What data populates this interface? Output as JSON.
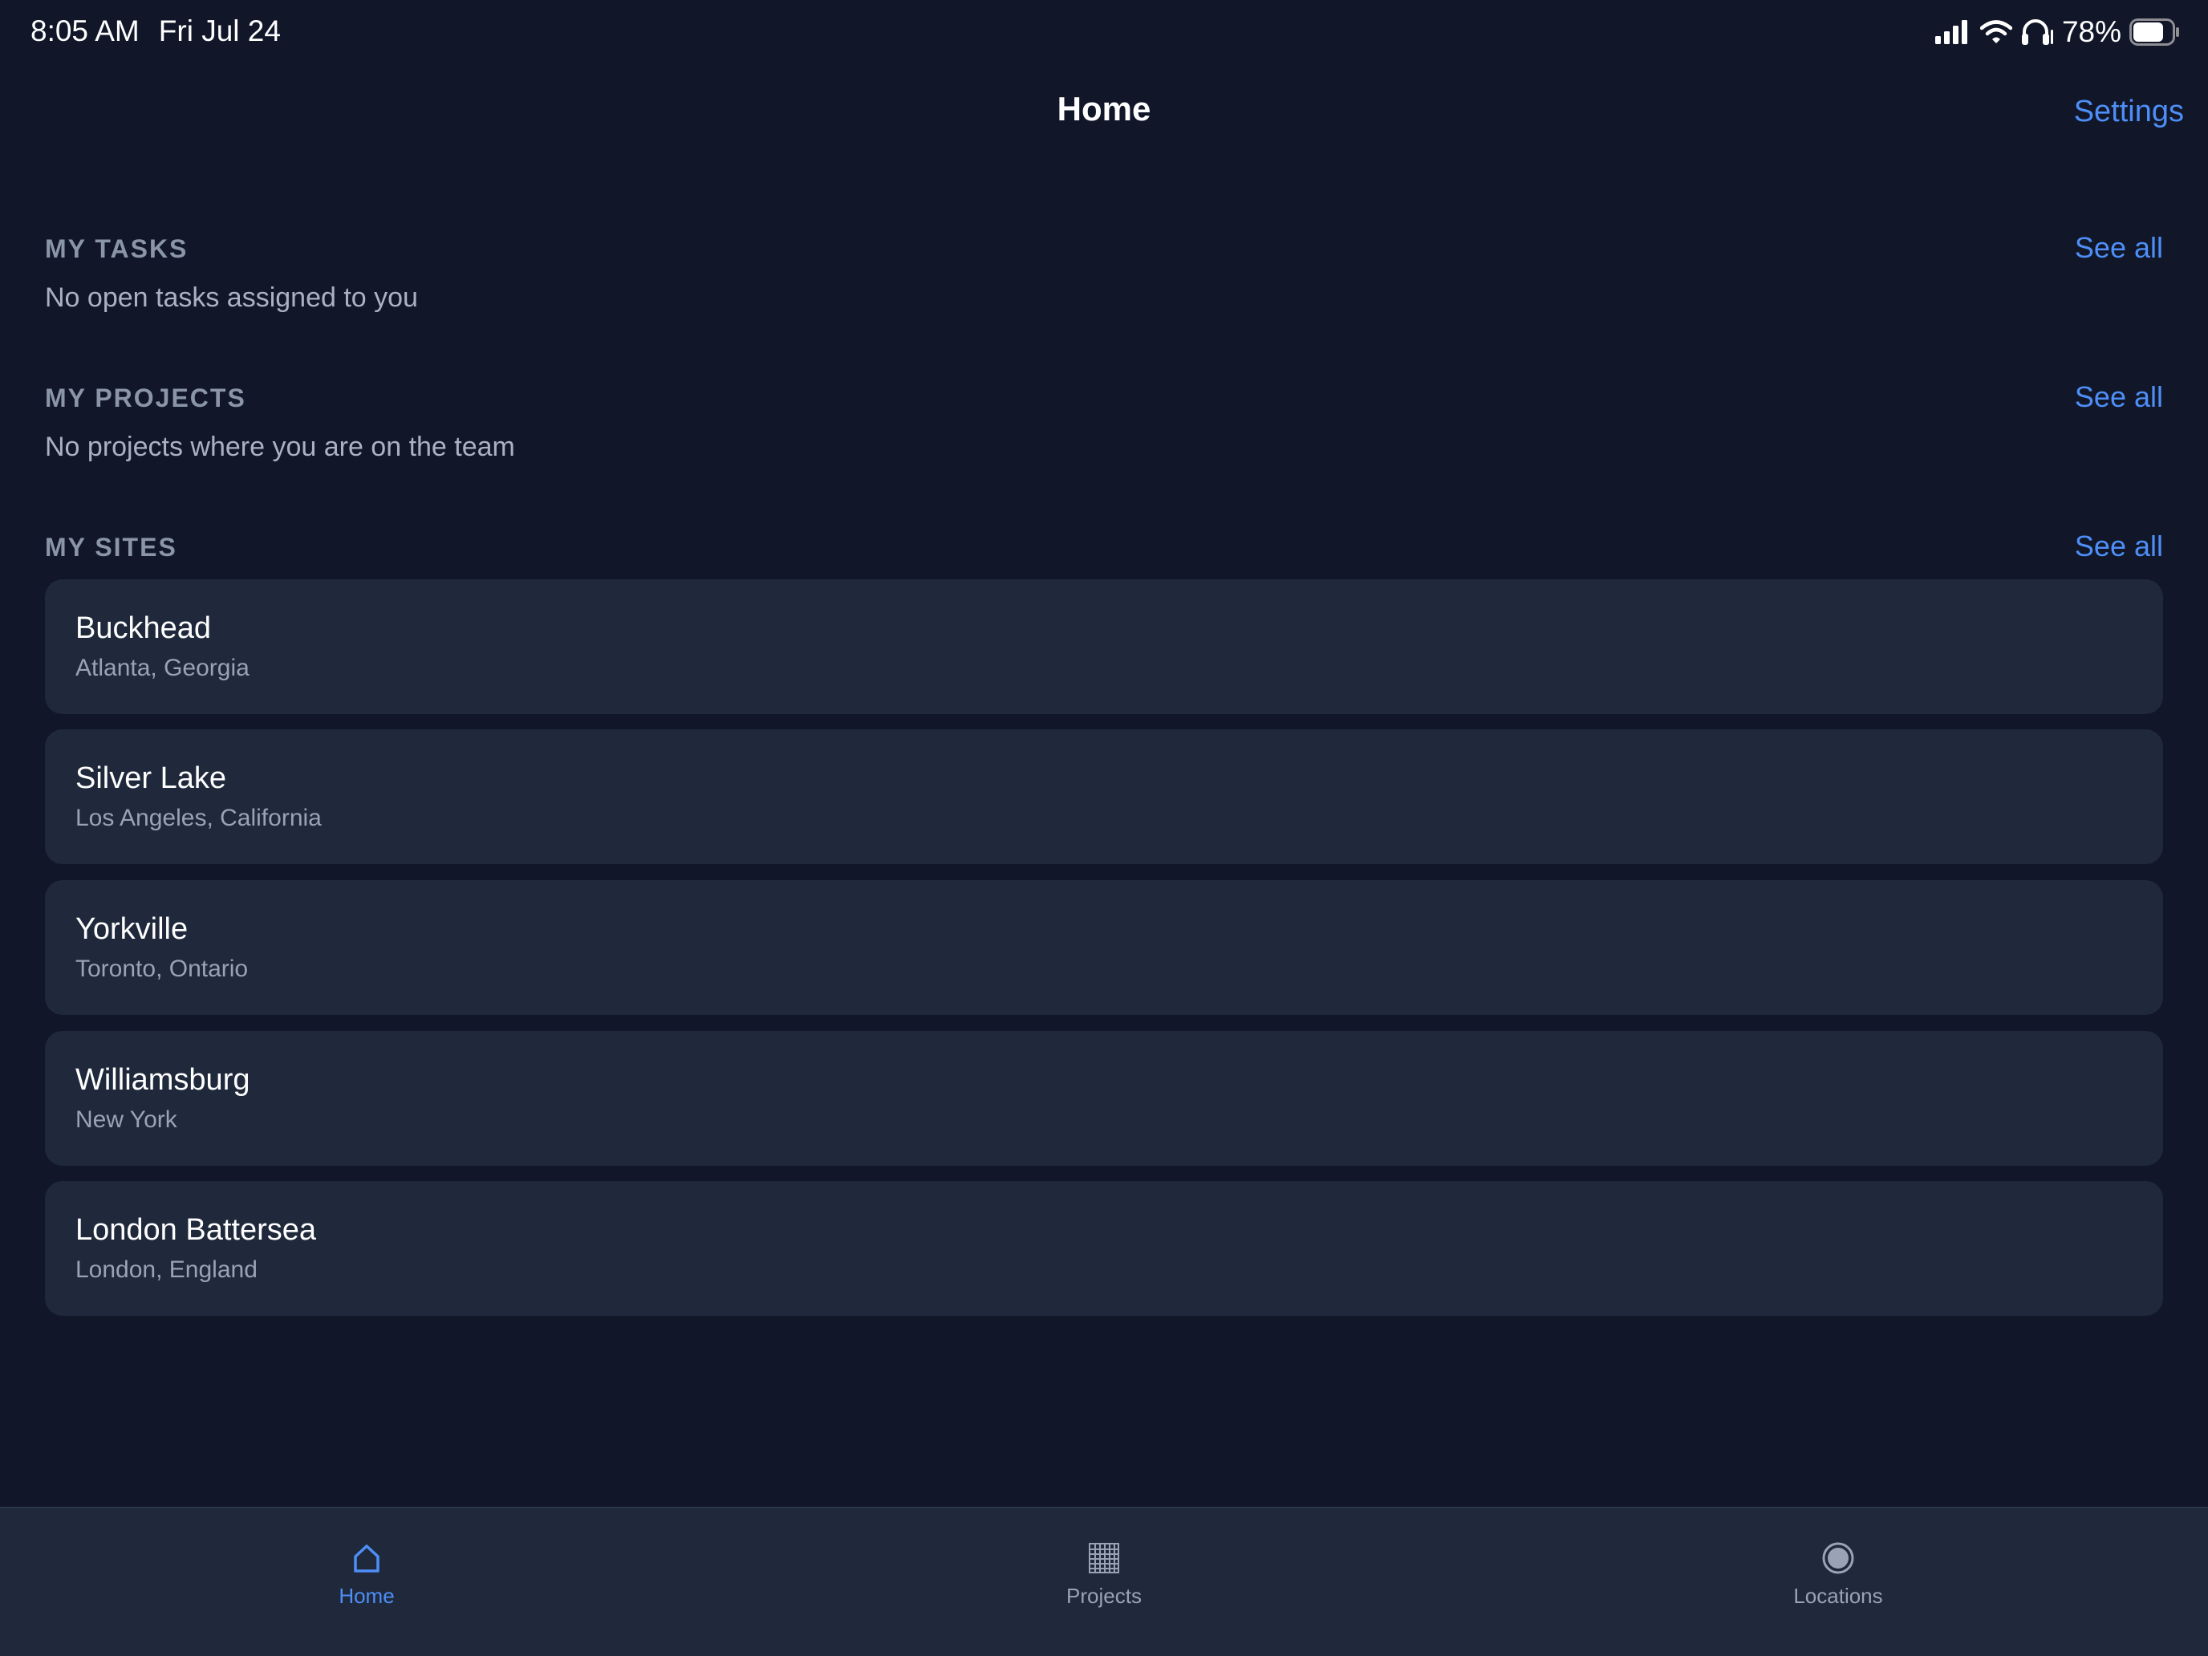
{
  "status_bar": {
    "time": "8:05 AM",
    "date": "Fri Jul 24",
    "battery_percent": "78%",
    "battery_level": 0.78
  },
  "nav": {
    "title": "Home",
    "settings_label": "Settings"
  },
  "sections": {
    "tasks": {
      "header": "MY TASKS",
      "see_all": "See all",
      "empty": "No open tasks assigned to you"
    },
    "projects": {
      "header": "MY PROJECTS",
      "see_all": "See all",
      "empty": "No projects where you are on the team"
    },
    "sites": {
      "header": "MY SITES",
      "see_all": "See all",
      "items": [
        {
          "name": "Buckhead",
          "location": "Atlanta, Georgia"
        },
        {
          "name": "Silver Lake",
          "location": "Los Angeles, California"
        },
        {
          "name": "Yorkville",
          "location": "Toronto, Ontario"
        },
        {
          "name": "Williamsburg",
          "location": "New York"
        },
        {
          "name": "London Battersea",
          "location": "London, England"
        }
      ]
    }
  },
  "tabs": [
    {
      "label": "Home",
      "icon": "home-icon",
      "active": true
    },
    {
      "label": "Projects",
      "icon": "grid-icon",
      "active": false
    },
    {
      "label": "Locations",
      "icon": "location-icon",
      "active": false
    }
  ],
  "colors": {
    "background": "#111729",
    "card": "#1f293b",
    "accent": "#4e8ef7"
  }
}
